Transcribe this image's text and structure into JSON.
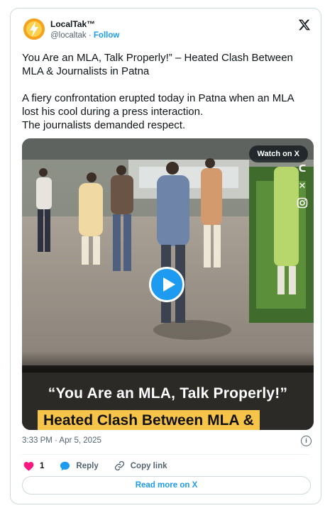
{
  "author": {
    "name": "LocalTak™",
    "handle": "@localtak",
    "separator": " · ",
    "follow_label": "Follow"
  },
  "tweet": {
    "headline": "You Are an MLA, Talk Properly!” – Heated Clash Between MLA & Journalists in Patna",
    "body_line1": "A fiery confrontation erupted today in Patna when an MLA lost his cool during a press interaction.",
    "body_line2": "The journalists demanded respect."
  },
  "media": {
    "watch_label": "Watch on X",
    "caption_line1": "“You Are an MLA, Talk Properly!”",
    "caption_line2": "Heated Clash Between MLA &",
    "social_icons": [
      "c",
      "x",
      "ig"
    ]
  },
  "meta": {
    "timestamp": "3:33 PM · Apr 5, 2025"
  },
  "actions": {
    "like_count": "1",
    "reply_label": "Reply",
    "copy_label": "Copy link",
    "read_more_label": "Read more on X"
  },
  "colors": {
    "accent": "#1d9bf0",
    "like": "#f91880",
    "caption_highlight": "#f7c44a"
  }
}
